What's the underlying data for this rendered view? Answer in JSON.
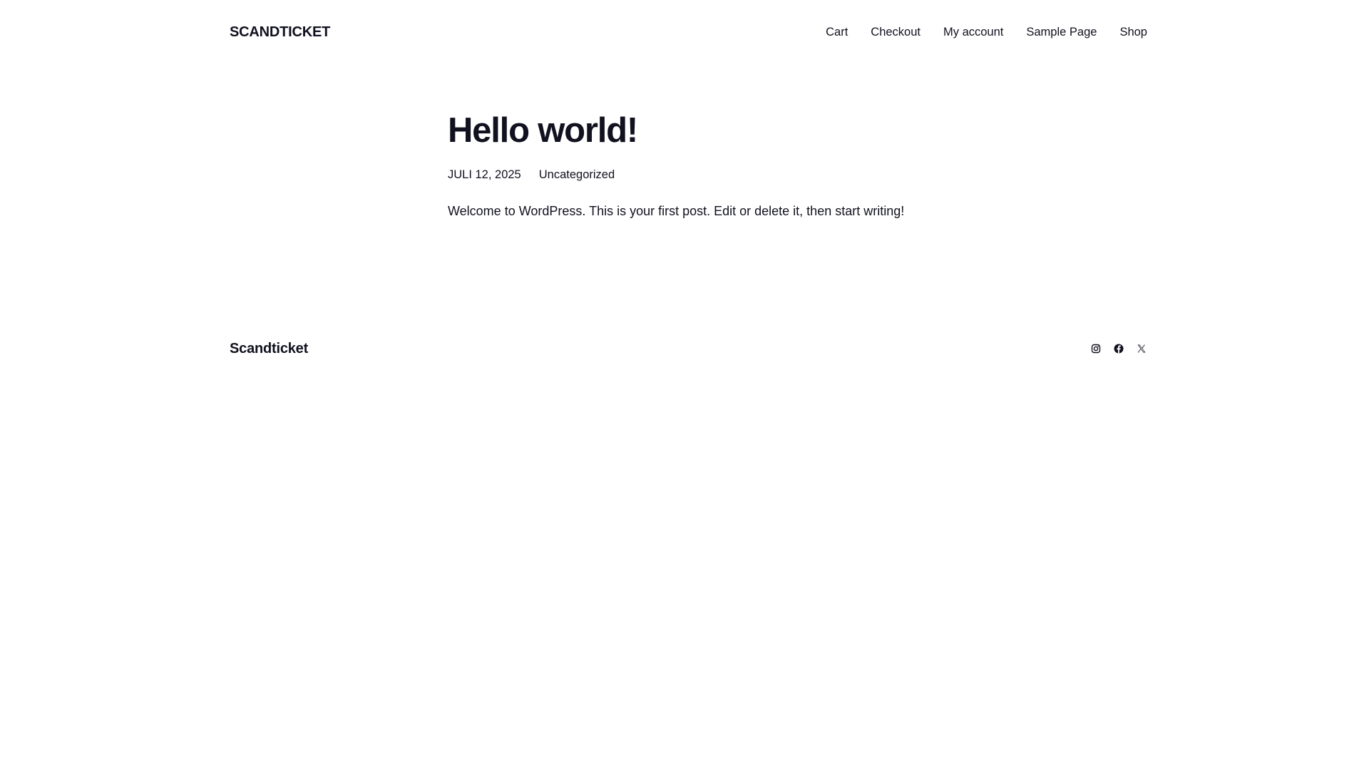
{
  "header": {
    "site_title": "SCANDTICKET",
    "nav": [
      {
        "label": "Cart"
      },
      {
        "label": "Checkout"
      },
      {
        "label": "My account"
      },
      {
        "label": "Sample Page"
      },
      {
        "label": "Shop"
      }
    ]
  },
  "post": {
    "title": "Hello world!",
    "date": "JULI 12, 2025",
    "category": "Uncategorized",
    "content": "Welcome to WordPress. This is your first post. Edit or delete it, then start writing!"
  },
  "footer": {
    "site_title": "Scandticket",
    "social_icons": [
      "instagram-icon",
      "facebook-icon",
      "x-icon"
    ]
  },
  "colors": {
    "text": "#11111f",
    "background": "#ffffff"
  }
}
